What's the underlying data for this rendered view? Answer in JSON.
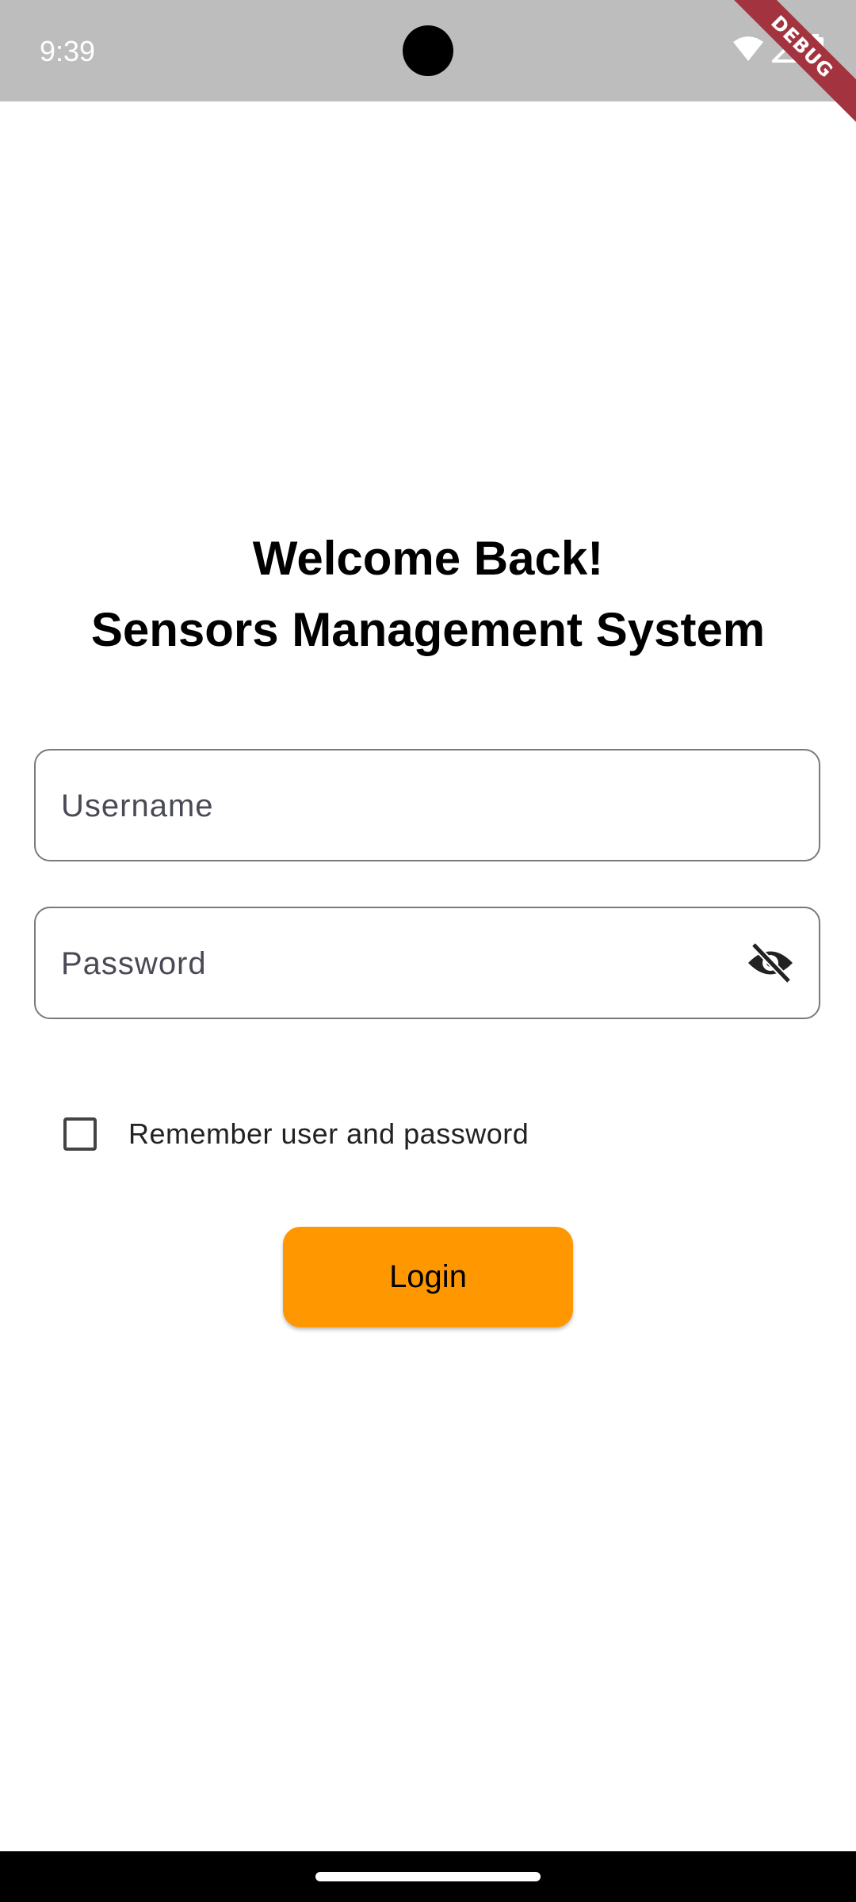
{
  "status_bar": {
    "time": "9:39",
    "icons": [
      "wifi-icon",
      "cellular-signal-icon",
      "battery-icon"
    ],
    "background": "#bdbdbd"
  },
  "debug_banner": {
    "label": "DEBUG",
    "color": "#a3343f"
  },
  "header": {
    "line1": "Welcome Back!",
    "line2": "Sensors Management System"
  },
  "form": {
    "username": {
      "value": "",
      "placeholder": "Username"
    },
    "password": {
      "value": "",
      "placeholder": "Password",
      "toggle_icon": "visibility-off-icon"
    },
    "remember": {
      "label": "Remember user and password",
      "checked": false
    },
    "login": {
      "label": "Login",
      "color": "#ff9800"
    }
  }
}
